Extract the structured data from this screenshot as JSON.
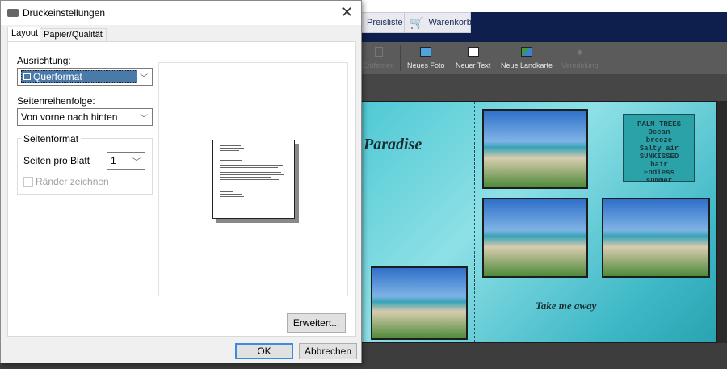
{
  "app": {
    "tabs": [
      {
        "label": "Preisliste"
      },
      {
        "label": "Warenkorb"
      }
    ],
    "toolbar": [
      {
        "label": "Entfernen",
        "icon": "trash-icon",
        "disabled": true
      },
      {
        "label": "Neues Foto",
        "icon": "add-photo-icon"
      },
      {
        "label": "Neuer Text",
        "icon": "add-text-icon"
      },
      {
        "label": "Neue Landkarte",
        "icon": "add-map-icon"
      },
      {
        "label": "Veredelung",
        "icon": "diamond-icon",
        "disabled": true
      }
    ],
    "canvas": {
      "title_art": "Paradise",
      "quote": [
        "PALM TREES",
        "Ocean",
        "breeze",
        "Salty air",
        "SUNKISSED",
        "hair",
        "Endless",
        "summer"
      ],
      "tagline": "Take me away"
    }
  },
  "dialog": {
    "title": "Druckeinstellungen",
    "tabs": [
      {
        "label": "Layout"
      },
      {
        "label": "Papier/Qualität"
      }
    ],
    "orientation_label": "Ausrichtung:",
    "orientation_value": "Querformat",
    "order_label": "Seitenreihenfolge:",
    "order_value": "Von vorne nach hinten",
    "format_group": "Seitenformat",
    "pages_per_sheet_label": "Seiten pro Blatt",
    "pages_per_sheet_value": "1",
    "borders_label": "Ränder zeichnen",
    "advanced_button": "Erweitert...",
    "ok_button": "OK",
    "cancel_button": "Abbrechen"
  }
}
